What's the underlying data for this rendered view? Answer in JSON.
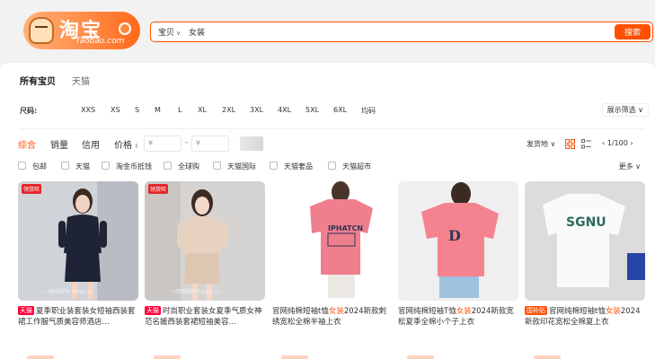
{
  "header": {
    "logo_text": "淘宝",
    "logo_subtext": "Taobao.com",
    "search": {
      "scope": "宝贝",
      "query": "女装",
      "button": "搜索"
    }
  },
  "tabs": [
    {
      "label": "所有宝贝",
      "active": true
    },
    {
      "label": "天猫",
      "active": false
    }
  ],
  "size_filter": {
    "label": "尺码:",
    "options": [
      "XXS",
      "XS",
      "S",
      "M",
      "L",
      "XL",
      "2XL",
      "3XL",
      "4XL",
      "5XL",
      "6XL",
      "均码"
    ],
    "display_filter": "展示筛选"
  },
  "sort_bar": {
    "options": [
      "综合",
      "销量",
      "信用",
      "价格"
    ],
    "active": "综合",
    "price_min_placeholder": "¥",
    "price_max_placeholder": "¥",
    "price_dash": "-",
    "ship_from": "发货地",
    "pager": "1/100"
  },
  "checkboxes": [
    "包邮",
    "天猫",
    "淘金币抵钱",
    "全球购",
    "天猫国际",
    "天猫奢品",
    "天猫超市"
  ],
  "more": "更多",
  "products": [
    {
      "badge": "天猫",
      "badge_style": "red",
      "title_before": "夏季职业装套装女短袖西装套裙工作服气质美容师酒店…",
      "highlight": "",
      "title_after": "",
      "image_tag": "领货旺",
      "watermark": "一缀绮视频 https://..."
    },
    {
      "badge": "天猫",
      "badge_style": "red",
      "title_before": "时尚职业套装女夏季气质女神范名媛西装套裙短袖美容…",
      "highlight": "",
      "title_after": "",
      "image_tag": "领货旺",
      "watermark": "一缀绮视频 https://..."
    },
    {
      "badge": "",
      "badge_style": "",
      "title_before": "官网纯棉短袖t恤",
      "highlight": "女装",
      "title_after": "2024新款刺绣宽松全棉半袖上衣",
      "image_tag": "",
      "watermark": ""
    },
    {
      "badge": "",
      "badge_style": "",
      "title_before": "官网纯棉短袖T恤",
      "highlight": "女装",
      "title_after": "2024新款宽松夏季全棉小个子上衣",
      "image_tag": "",
      "watermark": ""
    },
    {
      "badge": "国补贴",
      "badge_style": "orange",
      "title_before": "官网纯棉短袖t恤",
      "highlight": "女装",
      "title_after": "2024新款印花宽松全棉夏上衣",
      "image_tag": "",
      "watermark": ""
    }
  ],
  "colors": {
    "accent": "#ff5000",
    "tmall_red": "#ff0036",
    "panel_bg": "#ffffff",
    "page_bg": "#f2f2f2"
  }
}
